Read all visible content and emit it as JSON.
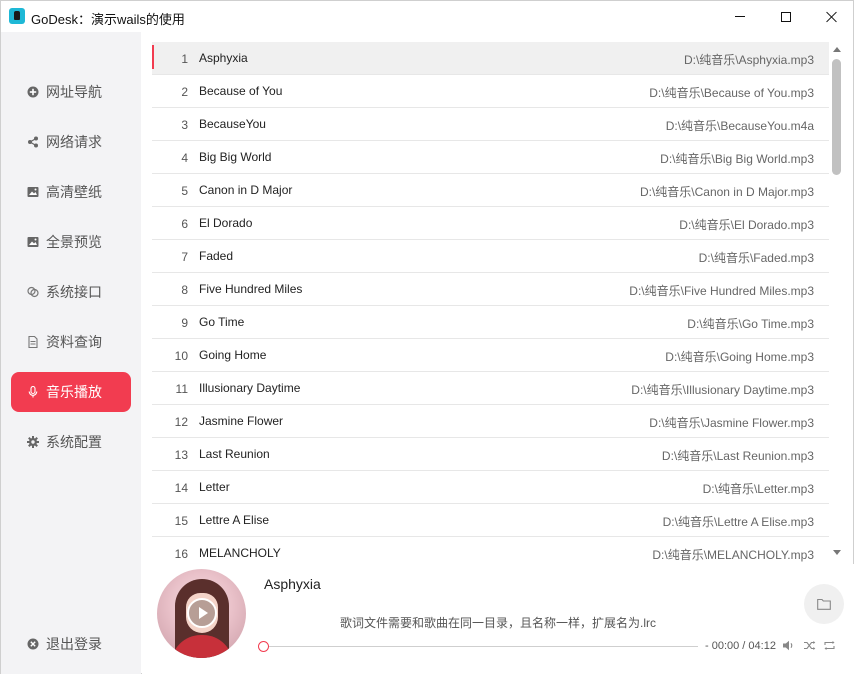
{
  "window": {
    "title": "GoDesk：演示wails的使用"
  },
  "sidebar": {
    "items": [
      {
        "label": "网址导航",
        "icon": "plus-circle-icon",
        "active": false
      },
      {
        "label": "网络请求",
        "icon": "share-icon",
        "active": false
      },
      {
        "label": "高清壁纸",
        "icon": "image-icon",
        "active": false
      },
      {
        "label": "全景预览",
        "icon": "image-icon",
        "active": false
      },
      {
        "label": "系统接口",
        "icon": "link-icon",
        "active": false
      },
      {
        "label": "资料查询",
        "icon": "document-icon",
        "active": false
      },
      {
        "label": "音乐播放",
        "icon": "microphone-icon",
        "active": true
      },
      {
        "label": "系统配置",
        "icon": "gear-icon",
        "active": false
      }
    ],
    "logout_label": "退出登录"
  },
  "songs": [
    {
      "index": "1",
      "name": "Asphyxia",
      "path": "D:\\纯音乐\\Asphyxia.mp3",
      "active": true
    },
    {
      "index": "2",
      "name": "Because of You",
      "path": "D:\\纯音乐\\Because of You.mp3"
    },
    {
      "index": "3",
      "name": "BecauseYou",
      "path": "D:\\纯音乐\\BecauseYou.m4a"
    },
    {
      "index": "4",
      "name": "Big Big World",
      "path": "D:\\纯音乐\\Big Big World.mp3"
    },
    {
      "index": "5",
      "name": "Canon in D Major",
      "path": "D:\\纯音乐\\Canon in D Major.mp3"
    },
    {
      "index": "6",
      "name": "El Dorado",
      "path": "D:\\纯音乐\\El Dorado.mp3"
    },
    {
      "index": "7",
      "name": "Faded",
      "path": "D:\\纯音乐\\Faded.mp3"
    },
    {
      "index": "8",
      "name": "Five Hundred Miles",
      "path": "D:\\纯音乐\\Five Hundred Miles.mp3"
    },
    {
      "index": "9",
      "name": "Go Time",
      "path": "D:\\纯音乐\\Go Time.mp3"
    },
    {
      "index": "10",
      "name": "Going Home",
      "path": "D:\\纯音乐\\Going Home.mp3"
    },
    {
      "index": "11",
      "name": "Illusionary Daytime",
      "path": "D:\\纯音乐\\Illusionary Daytime.mp3"
    },
    {
      "index": "12",
      "name": "Jasmine Flower",
      "path": "D:\\纯音乐\\Jasmine Flower.mp3"
    },
    {
      "index": "13",
      "name": "Last Reunion",
      "path": "D:\\纯音乐\\Last Reunion.mp3"
    },
    {
      "index": "14",
      "name": "Letter",
      "path": "D:\\纯音乐\\Letter.mp3"
    },
    {
      "index": "15",
      "name": "Lettre A Elise",
      "path": "D:\\纯音乐\\Lettre A Elise.mp3"
    },
    {
      "index": "16",
      "name": "MELANCHOLY",
      "path": "D:\\纯音乐\\MELANCHOLY.mp3"
    }
  ],
  "player": {
    "now_playing": "Asphyxia",
    "lyric_hint": "歌词文件需要和歌曲在同一目录，且名称一样，扩展名为.lrc",
    "time": "- 00:00 / 04:12",
    "progress": 0,
    "accent_color": "#f23c50"
  }
}
